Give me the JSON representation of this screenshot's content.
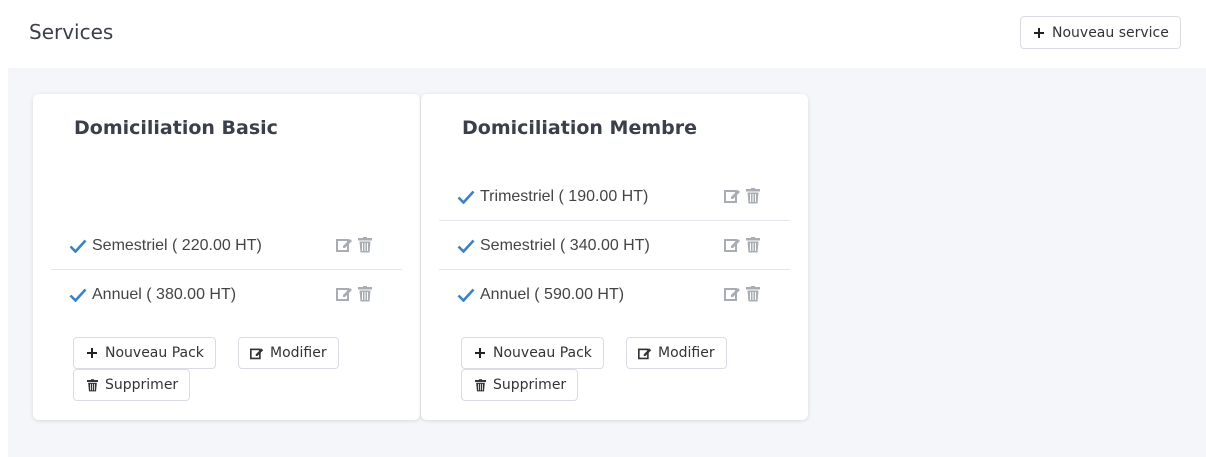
{
  "header": {
    "title": "Services",
    "new_service_label": "Nouveau service"
  },
  "cards": [
    {
      "title": "Domiciliation Basic",
      "packs": [
        {
          "label": "Semestriel ( 220.00 HT)"
        },
        {
          "label": "Annuel ( 380.00 HT)"
        }
      ],
      "buttons": {
        "new_pack": "Nouveau Pack",
        "modify": "Modifier",
        "delete": "Supprimer"
      }
    },
    {
      "title": "Domiciliation Membre",
      "packs": [
        {
          "label": "Trimestriel ( 190.00 HT)"
        },
        {
          "label": "Semestriel ( 340.00 HT)"
        },
        {
          "label": "Annuel ( 590.00 HT)"
        }
      ],
      "buttons": {
        "new_pack": "Nouveau Pack",
        "modify": "Modifier",
        "delete": "Supprimer"
      }
    }
  ],
  "colors": {
    "check": "#3b82c4",
    "icon_gray": "#a8adb3",
    "background": "#f4f6f9"
  },
  "icons": {
    "check": "check-icon",
    "edit": "edit-icon",
    "trash": "trash-icon",
    "plus": "plus-icon"
  }
}
